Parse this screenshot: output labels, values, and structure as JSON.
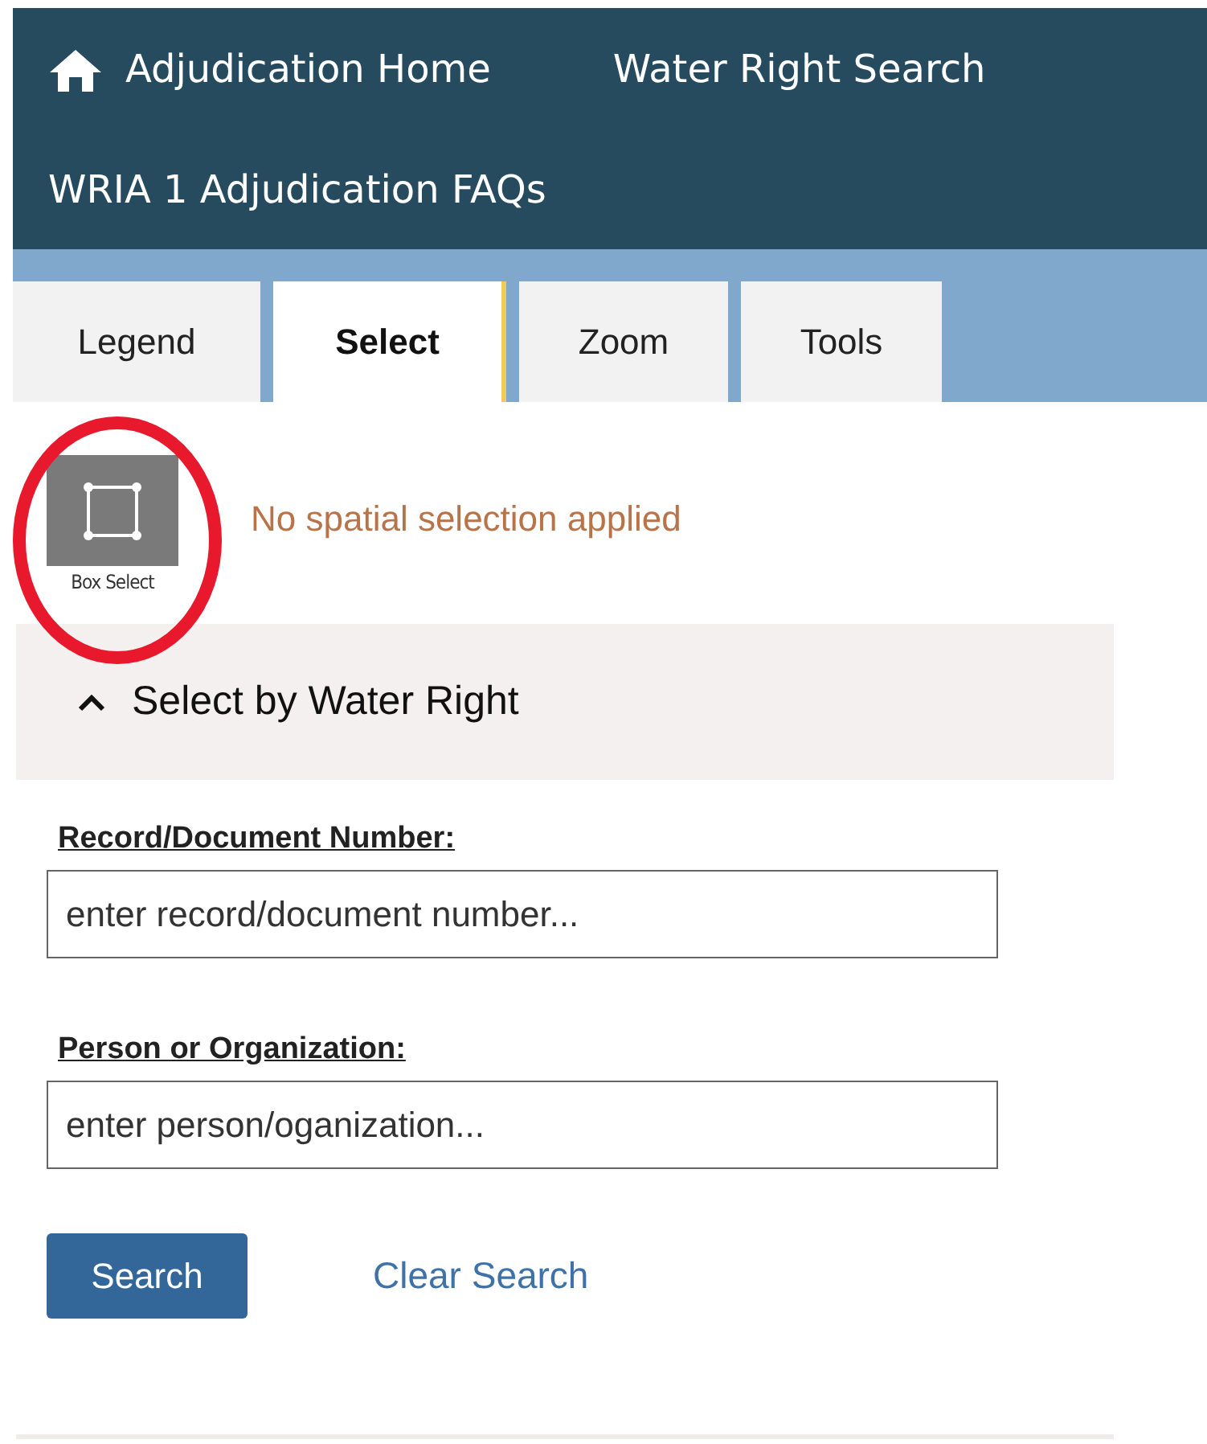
{
  "nav": {
    "links": [
      {
        "label": "Adjudication Home",
        "kind": "home"
      },
      {
        "label": "Water Right Search",
        "kind": "plain"
      },
      {
        "label": "WRIA 1 Adjudication FAQs",
        "kind": "plain"
      }
    ]
  },
  "tabs": [
    {
      "label": "Legend",
      "selected": false
    },
    {
      "label": "Select",
      "selected": true
    },
    {
      "label": "Zoom",
      "selected": false
    },
    {
      "label": "Tools",
      "selected": false
    }
  ],
  "spatial": {
    "tool_label": "Box Select",
    "status": "No spatial selection applied"
  },
  "annotation": {
    "kind": "ellipse"
  },
  "section": {
    "title": "Select by Water Right",
    "expanded": true,
    "fields": [
      {
        "label": "Record/Document Number:",
        "placeholder": "enter record/document number..."
      },
      {
        "label": "Person or Organization:",
        "placeholder": "enter person/oganization..."
      }
    ],
    "search_button": "Search",
    "clear_link": "Clear Search"
  }
}
